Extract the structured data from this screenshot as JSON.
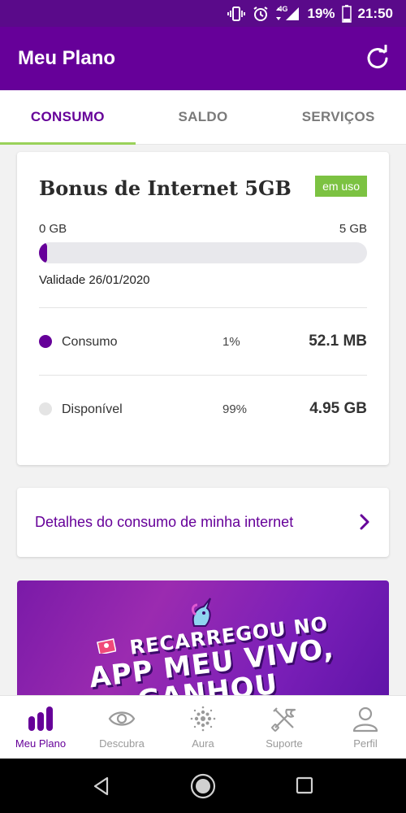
{
  "status_bar": {
    "battery": "19%",
    "time": "21:50",
    "network": "4G",
    "icons": [
      "vibrate-icon",
      "alarm-icon",
      "signal-icon",
      "battery-icon"
    ]
  },
  "app_bar": {
    "title": "Meu Plano",
    "refresh_icon": "refresh-icon"
  },
  "tabs": [
    {
      "label": "CONSUMO",
      "active": true
    },
    {
      "label": "SALDO",
      "active": false
    },
    {
      "label": "SERVIÇOS",
      "active": false
    }
  ],
  "plan": {
    "title": "Bonus de Internet 5GB",
    "badge": "em uso",
    "range_min": "0 GB",
    "range_max": "5 GB",
    "usage_fraction": 0.01,
    "validity": "Validade 26/01/2020",
    "rows": [
      {
        "label": "Consumo",
        "percent": "1%",
        "value": "52.1 MB",
        "dot_color": "#660099"
      },
      {
        "label": "Disponível",
        "percent": "99%",
        "value": "4.95 GB",
        "dot_color": "#e4e4e4"
      }
    ]
  },
  "details": {
    "label": "Detalhes do consumo de minha internet",
    "icon": "chevron-right-icon"
  },
  "banner": {
    "line1": "RECARREGOU NO",
    "line2": "APP MEU VIVO,",
    "line3": "GANHOU"
  },
  "bottom_nav": [
    {
      "label": "Meu Plano",
      "icon": "bar-chart-icon",
      "active": true
    },
    {
      "label": "Descubra",
      "icon": "eye-icon",
      "active": false
    },
    {
      "label": "Aura",
      "icon": "aura-dots-icon",
      "active": false
    },
    {
      "label": "Suporte",
      "icon": "tools-icon",
      "active": false
    },
    {
      "label": "Perfil",
      "icon": "user-icon",
      "active": false
    }
  ],
  "colors": {
    "brand_purple": "#660099",
    "accent_green": "#7cc242",
    "tab_indicator": "#9ad25a"
  }
}
